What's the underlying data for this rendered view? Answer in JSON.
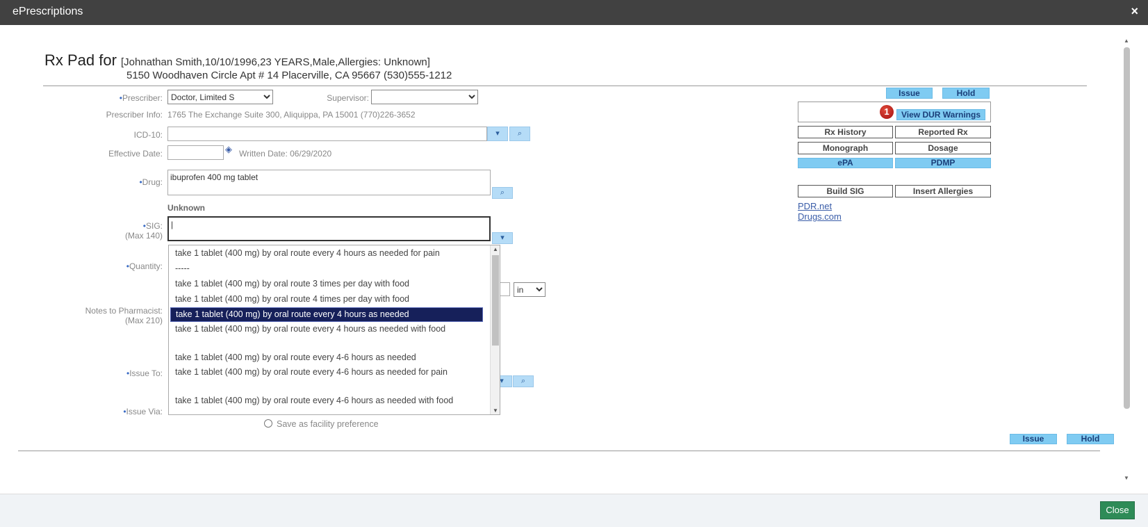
{
  "window": {
    "title": "ePrescriptions",
    "close_symbol": "×"
  },
  "header": {
    "rx_pad_label": "Rx Pad for",
    "patient_info": "[Johnathan Smith,10/10/1996,23 YEARS,Male,Allergies: Unknown]",
    "address": "5150 Woodhaven Circle Apt # 14 Placerville, CA 95667   (530)555-1212"
  },
  "form": {
    "prescriber_label": "Prescriber:",
    "prescriber_value": "Doctor, Limited S",
    "supervisor_label": "Supervisor:",
    "supervisor_value": "",
    "prescriber_info_label": "Prescriber Info:",
    "prescriber_info_value": "1765 The Exchange Suite 300, Aliquippa, PA 15001  (770)226-3652",
    "icd10_label": "ICD-10:",
    "effective_date_label": "Effective Date:",
    "written_date": "Written Date: 06/29/2020",
    "drug_label": "Drug:",
    "drug_value": "ibuprofen 400 mg tablet",
    "drug_status": "Unknown",
    "sig_label": "SIG:",
    "sig_max": "(Max 140)",
    "quantity_label": "Quantity:",
    "unit_value": "in",
    "notes_label": "Notes to Pharmacist:",
    "notes_max": "(Max 210)",
    "issue_to_label": "Issue To:",
    "issue_via_label": "Issue Via:",
    "save_facility_pref": "Save as facility preference"
  },
  "sig_dropdown": {
    "options": [
      "take 1 tablet (400 mg) by oral route every 4 hours as needed for pain",
      "-----",
      "take 1 tablet (400 mg) by oral route 3 times per day with food",
      "take 1 tablet (400 mg) by oral route 4 times per day with food",
      "take 1 tablet (400 mg) by oral route every 4 hours as needed",
      "take 1 tablet (400 mg) by oral route every 4 hours as needed with food",
      "take 1 tablet (400 mg) by oral route every 4-6 hours as needed",
      "take 1 tablet (400 mg) by oral route every 4-6 hours as needed for pain",
      "take 1 tablet (400 mg) by oral route every 4-6 hours as needed with food"
    ],
    "selected_index": 4
  },
  "panel": {
    "issue": "Issue",
    "hold": "Hold",
    "dur_count": "1",
    "view_dur": "View DUR Warnings",
    "rx_history": "Rx History",
    "reported_rx": "Reported Rx",
    "monograph": "Monograph",
    "dosage": "Dosage",
    "epa": "ePA",
    "pdmp": "PDMP",
    "build_sig": "Build SIG",
    "insert_allergies": "Insert Allergies",
    "pdr_link": "PDR.net",
    "drugs_link": "Drugs.com"
  },
  "bottom": {
    "issue": "Issue",
    "hold": "Hold"
  },
  "footer": {
    "close": "Close"
  }
}
